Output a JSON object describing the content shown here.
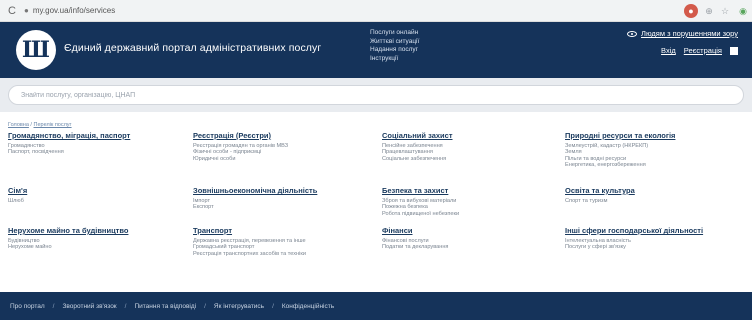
{
  "browser": {
    "reload_icon": "C",
    "lock_icon": "●",
    "url": "my.gov.ua/info/services",
    "ext_colors": [
      "#d35a4b",
      "#9aa0a6",
      "#9aa0a6",
      "#58a55c"
    ]
  },
  "header": {
    "logo_glyph": "Ш",
    "site_title": "Єдиний державний портал адміністративних послуг",
    "links": [
      "Послуги онлайн",
      "Життєві ситуації",
      "Надання послуг",
      "Інструкції"
    ],
    "low_vision_label": "Людям з порушеннями зору",
    "login_label": "Вхід",
    "register_label": "Реєстрація"
  },
  "search": {
    "placeholder": "Знайти послугу, організацію, ЦНАП"
  },
  "breadcrumb": {
    "home": "Головна",
    "separator": " / ",
    "current": "Перелік послуг"
  },
  "categories": [
    {
      "title": "Громадянство, міграція, паспорт",
      "items": [
        "Громадянство",
        "Паспорт, посвідчення"
      ]
    },
    {
      "title": "Реєстрація (Реєстри)",
      "items": [
        "Реєстрація громадян та органів МВЗ",
        "Фізичні особи - підприємці",
        "Юридичні особи"
      ]
    },
    {
      "title": "Соціальний захист",
      "items": [
        "Пенсійне забезпечення",
        "Працевлаштування",
        "Соціальне забезпечення"
      ]
    },
    {
      "title": "Природні ресурси та екологія",
      "items": [
        "Землеустрій, кадастр (НКРЕКП)",
        "Земля",
        "Пільги та водні ресурси",
        "Енергетика, енергозбереження"
      ]
    },
    {
      "title": "Сім'я",
      "items": [
        "Шлюб"
      ]
    },
    {
      "title": "Зовнішньоекономічна діяльність",
      "items": [
        "Імпорт",
        "Експорт"
      ]
    },
    {
      "title": "Безпека та захист",
      "items": [
        "Зброя та вибухові матеріали",
        "Пожежна безпека",
        "Робота підвищеної небезпеки"
      ]
    },
    {
      "title": "Освіта та культура",
      "items": [
        "Спорт та туризм"
      ]
    },
    {
      "title": "Нерухоме майно та будівництво",
      "items": [
        "Будівництво",
        "Нерухоме майно"
      ]
    },
    {
      "title": "Транспорт",
      "items": [
        "Державна реєстрація, перевезення та інше",
        "Громадський транспорт",
        "Реєстрація транспортних засобів та техніки"
      ]
    },
    {
      "title": "Фінанси",
      "items": [
        "Фінансові послуги",
        "Податки та декларування"
      ]
    },
    {
      "title": "Інші сфери господарської діяльності",
      "items": [
        "Інтелектуальна власність",
        "Послуги у сфері зв'язку"
      ]
    }
  ],
  "footer": {
    "links": [
      "Про портал",
      "Зворотний зв'язок",
      "Питання та відповіді",
      "Як інтегруватись",
      "Конфіденційність"
    ],
    "separator": "/"
  }
}
